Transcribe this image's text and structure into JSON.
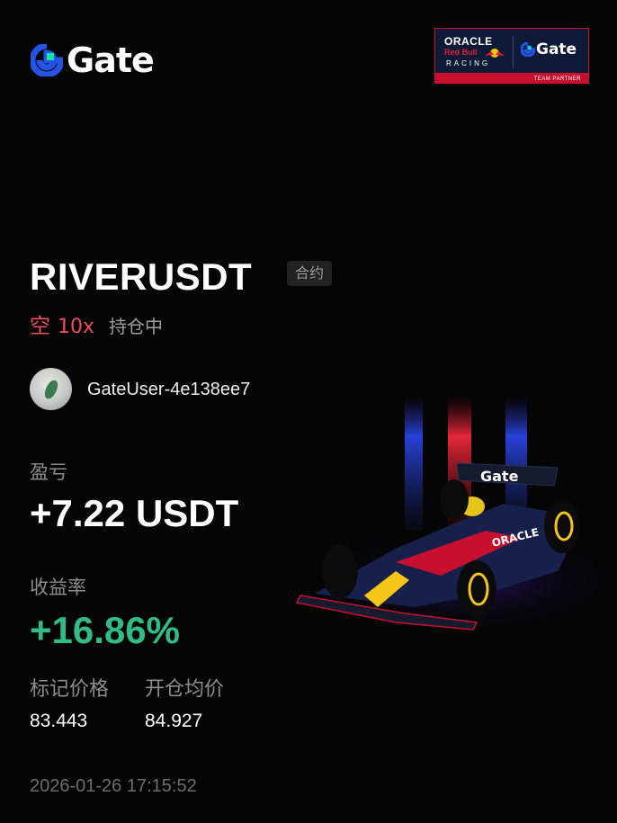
{
  "brand": {
    "name": "Gate",
    "logo_color": "#2354e6",
    "logo_accent": "#17e6a1"
  },
  "partner": {
    "oracle": "ORACLE",
    "redbull": "Red Bull",
    "racing": "RACING",
    "gate": "Gate",
    "label": "TEAM PARTNER"
  },
  "position": {
    "symbol": "RIVERUSDT",
    "tag": "合约",
    "side": "空",
    "leverage": "10x",
    "status": "持仓中",
    "side_color": "#f04a5b"
  },
  "user": {
    "name": "GateUser-4e138ee7"
  },
  "figures": {
    "pnl_label": "盈亏",
    "pnl_value": "+7.22 USDT",
    "roi_label": "收益率",
    "roi_value": "+16.86%",
    "roi_color": "#2ebd85",
    "mark_price_label": "标记价格",
    "mark_price": "83.443",
    "entry_price_label": "开仓均价",
    "entry_price": "84.927"
  },
  "timestamp": "2026-01-26 17:15:52",
  "car_art": {
    "car_text": "Gate",
    "sponsor_text": "ORACLE"
  }
}
